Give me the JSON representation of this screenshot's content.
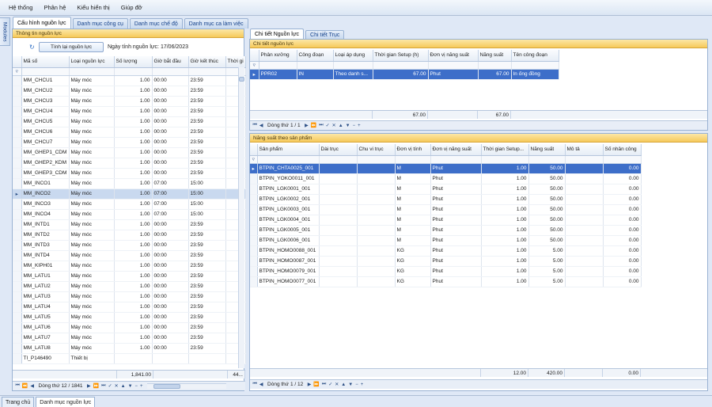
{
  "menu": [
    "Hệ thống",
    "Phân hệ",
    "Kiểu hiển thị",
    "Giúp đỡ"
  ],
  "side_tab": "Modules",
  "main_tabs": [
    "Cấu hình nguồn lực",
    "Danh mục công cụ",
    "Danh mục chế độ",
    "Danh mục ca làm việc"
  ],
  "left": {
    "header": "Thông tin nguồn lực",
    "button": "Tính lại nguồn lực",
    "date_text": "Ngày tính nguồn lực: 17/06/2023",
    "columns": [
      "Mã số",
      "Loại nguồn lực",
      "Số lượng",
      "Giờ bắt đầu",
      "Giờ kết thúc",
      "Thời gi"
    ],
    "rows": [
      [
        "MM_CHCU1",
        "Máy móc",
        "1.00",
        "00:00",
        "23:59"
      ],
      [
        "MM_CHCU2",
        "Máy móc",
        "1.00",
        "00:00",
        "23:59"
      ],
      [
        "MM_CHCU3",
        "Máy móc",
        "1.00",
        "00:00",
        "23:59"
      ],
      [
        "MM_CHCU4",
        "Máy móc",
        "1.00",
        "00:00",
        "23:59"
      ],
      [
        "MM_CHCU5",
        "Máy móc",
        "1.00",
        "00:00",
        "23:59"
      ],
      [
        "MM_CHCU6",
        "Máy móc",
        "1.00",
        "00:00",
        "23:59"
      ],
      [
        "MM_CHCU7",
        "Máy móc",
        "1.00",
        "00:00",
        "23:59"
      ],
      [
        "MM_GHEP1_CDM",
        "Máy móc",
        "1.00",
        "00:00",
        "23:59"
      ],
      [
        "MM_GHEP2_KDM",
        "Máy móc",
        "1.00",
        "00:00",
        "23:59"
      ],
      [
        "MM_GHEP3_CDM",
        "Máy móc",
        "1.00",
        "00:00",
        "23:59"
      ],
      [
        "MM_INCO1",
        "Máy móc",
        "1.00",
        "07:00",
        "15:00"
      ],
      [
        "MM_INCO2",
        "Máy móc",
        "1.00",
        "07:00",
        "15:00"
      ],
      [
        "MM_INCO3",
        "Máy móc",
        "1.00",
        "07:00",
        "15:00"
      ],
      [
        "MM_INCO4",
        "Máy móc",
        "1.00",
        "07:00",
        "15:00"
      ],
      [
        "MM_INTD1",
        "Máy móc",
        "1.00",
        "00:00",
        "23:59"
      ],
      [
        "MM_INTD2",
        "Máy móc",
        "1.00",
        "00:00",
        "23:59"
      ],
      [
        "MM_INTD3",
        "Máy móc",
        "1.00",
        "00:00",
        "23:59"
      ],
      [
        "MM_INTD4",
        "Máy móc",
        "1.00",
        "00:00",
        "23:59"
      ],
      [
        "MM_KIPH01",
        "Máy móc",
        "1.00",
        "00:00",
        "23:59"
      ],
      [
        "MM_LATU1",
        "Máy móc",
        "1.00",
        "00:00",
        "23:59"
      ],
      [
        "MM_LATU2",
        "Máy móc",
        "1.00",
        "00:00",
        "23:59"
      ],
      [
        "MM_LATU3",
        "Máy móc",
        "1.00",
        "00:00",
        "23:59"
      ],
      [
        "MM_LATU4",
        "Máy móc",
        "1.00",
        "00:00",
        "23:59"
      ],
      [
        "MM_LATU5",
        "Máy móc",
        "1.00",
        "00:00",
        "23:59"
      ],
      [
        "MM_LATU6",
        "Máy móc",
        "1.00",
        "00:00",
        "23:59"
      ],
      [
        "MM_LATU7",
        "Máy móc",
        "1.00",
        "00:00",
        "23:59"
      ],
      [
        "MM_LATU8",
        "Máy móc",
        "1.00",
        "00:00",
        "23:59"
      ],
      [
        "TI_P146490",
        "Thiết bị",
        "",
        "",
        ""
      ]
    ],
    "selected_row": 11,
    "footer_total": "1,841.00",
    "footer_extra": "44...",
    "nav_text": "Dòng thứ 12 / 1841"
  },
  "right_tabs": [
    "Chi tiết Nguồn lực",
    "Chi tiết Trục"
  ],
  "detail": {
    "header": "Chi tiết nguồn lực",
    "columns": [
      "Phân xưởng",
      "Công đoạn",
      "Loại áp dụng",
      "Thời gian Setup (h)",
      "Đơn vị năng suất",
      "Năng suất",
      "Tên công đoạn"
    ],
    "rows": [
      [
        "PPR02",
        "IN",
        "Theo danh s...",
        "67.00",
        "Phut",
        "67.00",
        "In ống đồng"
      ]
    ],
    "footer": [
      "67.00",
      "67.00"
    ],
    "nav_text": "Dòng thứ 1 / 1"
  },
  "product": {
    "header": "Năng suất theo sản phẩm",
    "columns": [
      "Sản phẩm",
      "Dài trục",
      "Chu vi trục",
      "Đơn vị tính",
      "Đơn vị năng suất",
      "Thời gian Setup...",
      "Năng suất",
      "Mô tả",
      "Số nhân công"
    ],
    "rows": [
      [
        "BTPIN_CHTA0025_001",
        "",
        "",
        "M",
        "Phut",
        "1.00",
        "50.00",
        "",
        "0.00"
      ],
      [
        "BTPIN_YOKO0011_001",
        "",
        "",
        "M",
        "Phut",
        "1.00",
        "50.00",
        "",
        "0.00"
      ],
      [
        "BTPIN_LGK0001_001",
        "",
        "",
        "M",
        "Phut",
        "1.00",
        "50.00",
        "",
        "0.00"
      ],
      [
        "BTPIN_LGK0002_001",
        "",
        "",
        "M",
        "Phut",
        "1.00",
        "50.00",
        "",
        "0.00"
      ],
      [
        "BTPIN_LGK0003_001",
        "",
        "",
        "M",
        "Phut",
        "1.00",
        "50.00",
        "",
        "0.00"
      ],
      [
        "BTPIN_LGK0004_001",
        "",
        "",
        "M",
        "Phut",
        "1.00",
        "50.00",
        "",
        "0.00"
      ],
      [
        "BTPIN_LGK0005_001",
        "",
        "",
        "M",
        "Phut",
        "1.00",
        "50.00",
        "",
        "0.00"
      ],
      [
        "BTPIN_LGK0006_001",
        "",
        "",
        "M",
        "Phut",
        "1.00",
        "50.00",
        "",
        "0.00"
      ],
      [
        "BTPIN_HOMO0088_001",
        "",
        "",
        "KG",
        "Phut",
        "1.00",
        "5.00",
        "",
        "0.00"
      ],
      [
        "BTPIN_HOMO0087_001",
        "",
        "",
        "KG",
        "Phut",
        "1.00",
        "5.00",
        "",
        "0.00"
      ],
      [
        "BTPIN_HOMO0079_001",
        "",
        "",
        "KG",
        "Phut",
        "1.00",
        "5.00",
        "",
        "0.00"
      ],
      [
        "BTPIN_HOMO0077_001",
        "",
        "",
        "KG",
        "Phut",
        "1.00",
        "5.00",
        "",
        "0.00"
      ]
    ],
    "footer": [
      "12.00",
      "420.00",
      "0.00"
    ],
    "nav_text": "Dòng thứ 1 / 12"
  },
  "bottom_tabs": [
    "Trang chủ",
    "Danh mục nguồn lực"
  ]
}
